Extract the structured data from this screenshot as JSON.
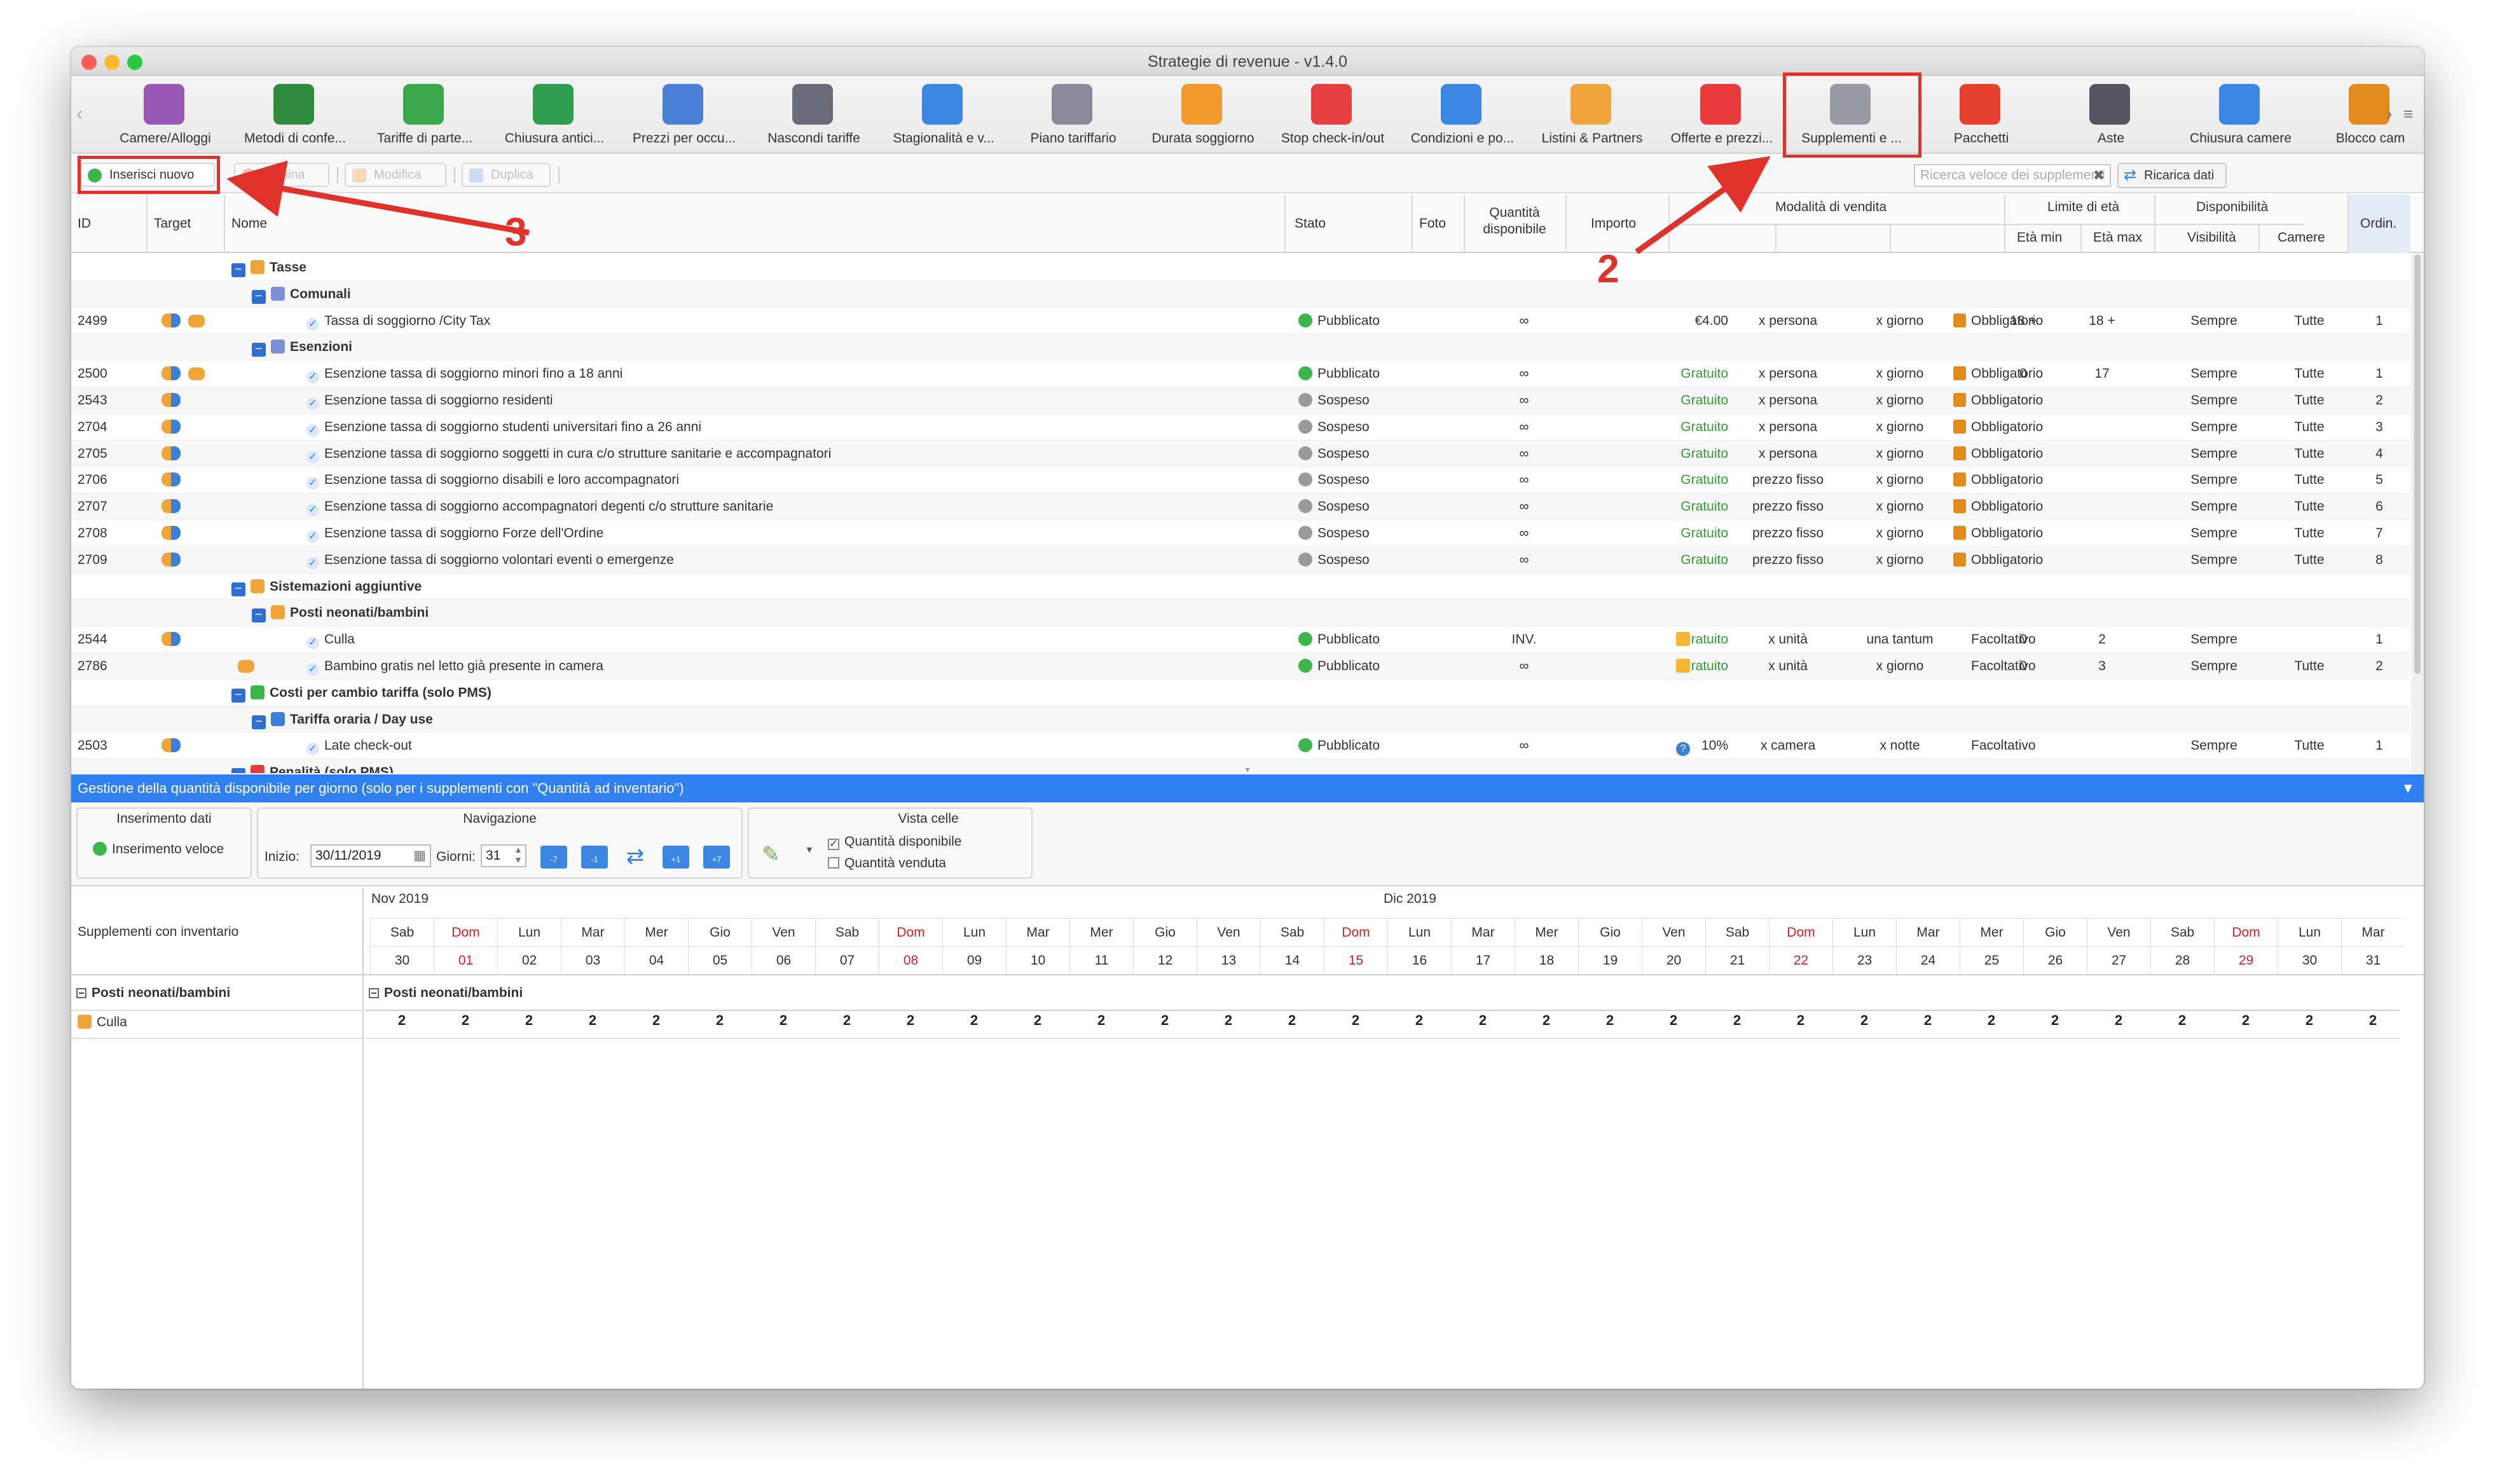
{
  "window": {
    "title": "Strategie di revenue - v1.4.0"
  },
  "toolbar": {
    "items": [
      {
        "label": "Camere/Alloggi",
        "icon": "bed-icon",
        "color": "#9b59b6"
      },
      {
        "label": "Metodi di confe...",
        "icon": "money-icon",
        "color": "#2e8b3d"
      },
      {
        "label": "Tariffe di parte...",
        "icon": "tag-icon",
        "color": "#3aa84a"
      },
      {
        "label": "Chiusura antici...",
        "icon": "timer-icon",
        "color": "#2e9e4e"
      },
      {
        "label": "Prezzi per occu...",
        "icon": "chart-icon",
        "color": "#4a7fd6"
      },
      {
        "label": "Nascondi tariffe",
        "icon": "hide-icon",
        "color": "#6a6a78"
      },
      {
        "label": "Stagionalità e v...",
        "icon": "calendar-arrows-icon",
        "color": "#3c86e3"
      },
      {
        "label": "Piano tariffario",
        "icon": "grid-icon",
        "color": "#8a8a9a"
      },
      {
        "label": "Durata soggiorno",
        "icon": "calendar-icon",
        "color": "#f29a2e"
      },
      {
        "label": "Stop check-in/out",
        "icon": "stop-icon",
        "color": "#e84040"
      },
      {
        "label": "Condizioni e po...",
        "icon": "document-icon",
        "color": "#3c86e3"
      },
      {
        "label": "Listini & Partners",
        "icon": "handshake-icon",
        "color": "#f0a53a"
      },
      {
        "label": "Offerte e prezzi...",
        "icon": "percent-icon",
        "color": "#e83a3a"
      },
      {
        "label": "Supplementi e ...",
        "icon": "room-service-icon",
        "color": "#9a9aa4"
      },
      {
        "label": "Pacchetti",
        "icon": "gift-icon",
        "color": "#e8402e"
      },
      {
        "label": "Aste",
        "icon": "gavel-icon",
        "color": "#555560"
      },
      {
        "label": "Chiusura camere",
        "icon": "calendar-lock-icon",
        "color": "#3c86e3"
      },
      {
        "label": "Blocco cam",
        "icon": "lock-icon",
        "color": "#e38a1c"
      }
    ]
  },
  "actions": {
    "insert": "Inserisci nuovo",
    "delete": "Elimina",
    "edit": "Modifica",
    "duplicate": "Duplica",
    "search_placeholder": "Ricerca veloce dei supplementi",
    "reload": "Ricarica dati"
  },
  "table": {
    "headers": {
      "id": "ID",
      "target": "Target",
      "name": "Nome",
      "stato": "Stato",
      "foto": "Foto",
      "qty": "Quantità disponibile",
      "importo": "Importo",
      "modalita": "Modalità di vendita",
      "limite": "Limite di età",
      "eta_min": "Età min",
      "eta_max": "Età max",
      "disp": "Disponibilità",
      "visibilita": "Visibilità",
      "camere": "Camere",
      "ordin": "Ordin."
    },
    "groups": {
      "g1": "Tasse",
      "g1a": "Comunali",
      "g1b": "Esenzioni",
      "g2": "Sistemazioni aggiuntive",
      "g2a": "Posti neonati/bambini",
      "g3": "Costi per cambio tariffa (solo PMS)",
      "g3a": "Tariffa oraria / Day use",
      "g4": "Penalità (solo PMS)"
    },
    "rows": [
      {
        "id": "2499",
        "name": "Tassa di soggiorno /City Tax",
        "stato": "Pubblicato",
        "qty": "∞",
        "imp": "€4.00",
        "m1": "x persona",
        "m2": "x giorno",
        "m3": "Obbligatorio",
        "e1": "18 +",
        "e2": "18 +",
        "vis": "Sempre",
        "cam": "Tutte",
        "ord": "1"
      },
      {
        "id": "2500",
        "name": "Esenzione tassa di soggiorno minori fino a 18 anni",
        "stato": "Pubblicato",
        "qty": "∞",
        "imp": "Gratuito",
        "m1": "x persona",
        "m2": "x giorno",
        "m3": "Obbligatorio",
        "e1": "0",
        "e2": "17",
        "vis": "Sempre",
        "cam": "Tutte",
        "ord": "1"
      },
      {
        "id": "2543",
        "name": "Esenzione tassa di soggiorno residenti",
        "stato": "Sospeso",
        "qty": "∞",
        "imp": "Gratuito",
        "m1": "x persona",
        "m2": "x giorno",
        "m3": "Obbligatorio",
        "e1": "",
        "e2": "",
        "vis": "Sempre",
        "cam": "Tutte",
        "ord": "2"
      },
      {
        "id": "2704",
        "name": "Esenzione tassa di soggiorno studenti universitari fino a 26 anni",
        "stato": "Sospeso",
        "qty": "∞",
        "imp": "Gratuito",
        "m1": "x persona",
        "m2": "x giorno",
        "m3": "Obbligatorio",
        "e1": "",
        "e2": "",
        "vis": "Sempre",
        "cam": "Tutte",
        "ord": "3"
      },
      {
        "id": "2705",
        "name": "Esenzione tassa di soggiorno soggetti in cura c/o strutture sanitarie e accompagnatori",
        "stato": "Sospeso",
        "qty": "∞",
        "imp": "Gratuito",
        "m1": "x persona",
        "m2": "x giorno",
        "m3": "Obbligatorio",
        "e1": "",
        "e2": "",
        "vis": "Sempre",
        "cam": "Tutte",
        "ord": "4"
      },
      {
        "id": "2706",
        "name": "Esenzione tassa di soggiorno disabili e loro accompagnatori",
        "stato": "Sospeso",
        "qty": "∞",
        "imp": "Gratuito",
        "m1": "prezzo fisso",
        "m2": "x giorno",
        "m3": "Obbligatorio",
        "e1": "",
        "e2": "",
        "vis": "Sempre",
        "cam": "Tutte",
        "ord": "5"
      },
      {
        "id": "2707",
        "name": "Esenzione tassa di soggiorno accompagnatori degenti c/o strutture sanitarie",
        "stato": "Sospeso",
        "qty": "∞",
        "imp": "Gratuito",
        "m1": "prezzo fisso",
        "m2": "x giorno",
        "m3": "Obbligatorio",
        "e1": "",
        "e2": "",
        "vis": "Sempre",
        "cam": "Tutte",
        "ord": "6"
      },
      {
        "id": "2708",
        "name": "Esenzione tassa di soggiorno Forze dell'Ordine",
        "stato": "Sospeso",
        "qty": "∞",
        "imp": "Gratuito",
        "m1": "prezzo fisso",
        "m2": "x giorno",
        "m3": "Obbligatorio",
        "e1": "",
        "e2": "",
        "vis": "Sempre",
        "cam": "Tutte",
        "ord": "7"
      },
      {
        "id": "2709",
        "name": "Esenzione tassa di soggiorno volontari eventi o emergenze",
        "stato": "Sospeso",
        "qty": "∞",
        "imp": "Gratuito",
        "m1": "prezzo fisso",
        "m2": "x giorno",
        "m3": "Obbligatorio",
        "e1": "",
        "e2": "",
        "vis": "Sempre",
        "cam": "Tutte",
        "ord": "8"
      },
      {
        "id": "2544",
        "name": "Culla",
        "stato": "Pubblicato",
        "qty": "INV.",
        "imp": "Gratuito",
        "m1": "x unità",
        "m2": "una tantum",
        "m3": "Facoltativo",
        "e1": "0",
        "e2": "2",
        "vis": "Sempre",
        "cam": "",
        "ord": "1"
      },
      {
        "id": "2786",
        "name": "Bambino gratis nel letto già presente in camera",
        "stato": "Pubblicato",
        "qty": "∞",
        "imp": "Gratuito",
        "m1": "x unità",
        "m2": "x giorno",
        "m3": "Facoltativo",
        "e1": "0",
        "e2": "3",
        "vis": "Sempre",
        "cam": "Tutte",
        "ord": "2"
      },
      {
        "id": "2503",
        "name": "Late check-out",
        "stato": "Pubblicato",
        "qty": "∞",
        "imp": "10%",
        "m1": "x camera",
        "m2": "x notte",
        "m3": "Facoltativo",
        "e1": "",
        "e2": "",
        "vis": "Sempre",
        "cam": "Tutte",
        "ord": "1"
      }
    ]
  },
  "inventory": {
    "bar_title": "Gestione della quantità disponibile per giorno (solo per i supplementi con \"Quantità ad inventario\")",
    "data_entry": "Inserimento dati",
    "quick_insert": "Inserimento veloce",
    "navigation": "Navigazione",
    "start_label": "Inizio:",
    "start_value": "30/11/2019",
    "days_label": "Giorni:",
    "days_value": "31",
    "nav_buttons": [
      "-7",
      "-1",
      "+1",
      "+7"
    ],
    "view_label": "Vista celle",
    "opt_available": "Quantità disponibile",
    "opt_sold": "Quantità venduta",
    "left_title": "Supplementi con inventario",
    "section": "Posti neonati/bambini",
    "item": "Culla",
    "months": [
      "Nov 2019",
      "Dic 2019"
    ],
    "days": [
      {
        "w": "Sab",
        "d": "30"
      },
      {
        "w": "Dom",
        "d": "01"
      },
      {
        "w": "Lun",
        "d": "02"
      },
      {
        "w": "Mar",
        "d": "03"
      },
      {
        "w": "Mer",
        "d": "04"
      },
      {
        "w": "Gio",
        "d": "05"
      },
      {
        "w": "Ven",
        "d": "06"
      },
      {
        "w": "Sab",
        "d": "07"
      },
      {
        "w": "Dom",
        "d": "08"
      },
      {
        "w": "Lun",
        "d": "09"
      },
      {
        "w": "Mar",
        "d": "10"
      },
      {
        "w": "Mer",
        "d": "11"
      },
      {
        "w": "Gio",
        "d": "12"
      },
      {
        "w": "Ven",
        "d": "13"
      },
      {
        "w": "Sab",
        "d": "14"
      },
      {
        "w": "Dom",
        "d": "15"
      },
      {
        "w": "Lun",
        "d": "16"
      },
      {
        "w": "Mar",
        "d": "17"
      },
      {
        "w": "Mer",
        "d": "18"
      },
      {
        "w": "Gio",
        "d": "19"
      },
      {
        "w": "Ven",
        "d": "20"
      },
      {
        "w": "Sab",
        "d": "21"
      },
      {
        "w": "Dom",
        "d": "22"
      },
      {
        "w": "Lun",
        "d": "23"
      },
      {
        "w": "Mar",
        "d": "24"
      },
      {
        "w": "Mer",
        "d": "25"
      },
      {
        "w": "Gio",
        "d": "26"
      },
      {
        "w": "Ven",
        "d": "27"
      },
      {
        "w": "Sab",
        "d": "28"
      },
      {
        "w": "Dom",
        "d": "29"
      },
      {
        "w": "Lun",
        "d": "30"
      },
      {
        "w": "Mar",
        "d": "31"
      }
    ],
    "qty_values": [
      "2",
      "2",
      "2",
      "2",
      "2",
      "2",
      "2",
      "2",
      "2",
      "2",
      "2",
      "2",
      "2",
      "2",
      "2",
      "2",
      "2",
      "2",
      "2",
      "2",
      "2",
      "2",
      "2",
      "2",
      "2",
      "2",
      "2",
      "2",
      "2",
      "2",
      "2",
      "2"
    ]
  },
  "annotations": {
    "label_2": "2",
    "label_3": "3"
  },
  "colors": {
    "accent": "#2f80f0",
    "highlight": "#e0322a",
    "published": "#3cb54a",
    "suspended": "#9a9a9a",
    "free": "#2e9e2e"
  }
}
